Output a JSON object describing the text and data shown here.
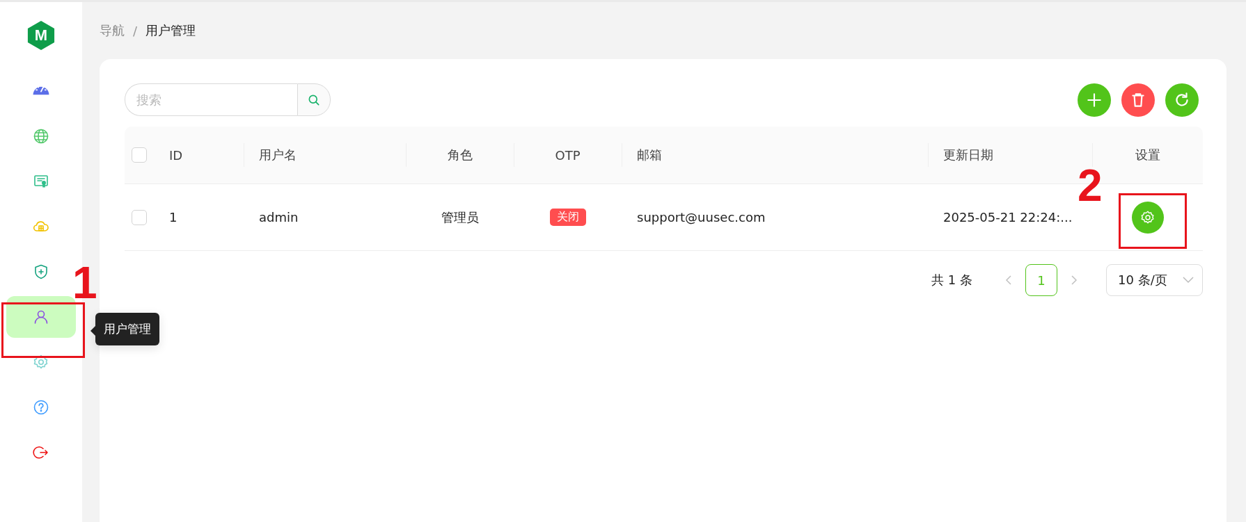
{
  "sidebar": {
    "logo": "M",
    "items": [
      {
        "kind": "dashboard",
        "selected": false
      },
      {
        "kind": "globe",
        "selected": false
      },
      {
        "kind": "certificate",
        "selected": false
      },
      {
        "kind": "cloud",
        "selected": false
      },
      {
        "kind": "shield",
        "selected": false
      },
      {
        "kind": "user",
        "selected": true
      },
      {
        "kind": "settings",
        "selected": false
      },
      {
        "kind": "help",
        "selected": false
      },
      {
        "kind": "logout",
        "selected": false
      }
    ],
    "tooltip": "用户管理"
  },
  "breadcrumb": {
    "separator": "/",
    "items": [
      "导航",
      "用户管理"
    ]
  },
  "search": {
    "placeholder": "搜索"
  },
  "toolbar": [
    {
      "kind": "add"
    },
    {
      "kind": "delete"
    },
    {
      "kind": "refresh"
    }
  ],
  "table": {
    "columns": [
      "ID",
      "用户名",
      "角色",
      "OTP",
      "邮箱",
      "更新日期",
      "设置"
    ],
    "header_checked": false,
    "rows": [
      {
        "checked": false,
        "id": "1",
        "username": "admin",
        "role": "管理员",
        "otp": {
          "label": "关闭",
          "on": false
        },
        "email": "support@uusec.com",
        "updated": "2025-05-21 22:24:..."
      }
    ]
  },
  "pagination": {
    "total": "共 1 条",
    "pages": [
      {
        "label": "1",
        "selected": true
      }
    ],
    "page_size": "10 条/页"
  },
  "annotations": [
    {
      "label": "1"
    },
    {
      "label": "2"
    }
  ]
}
